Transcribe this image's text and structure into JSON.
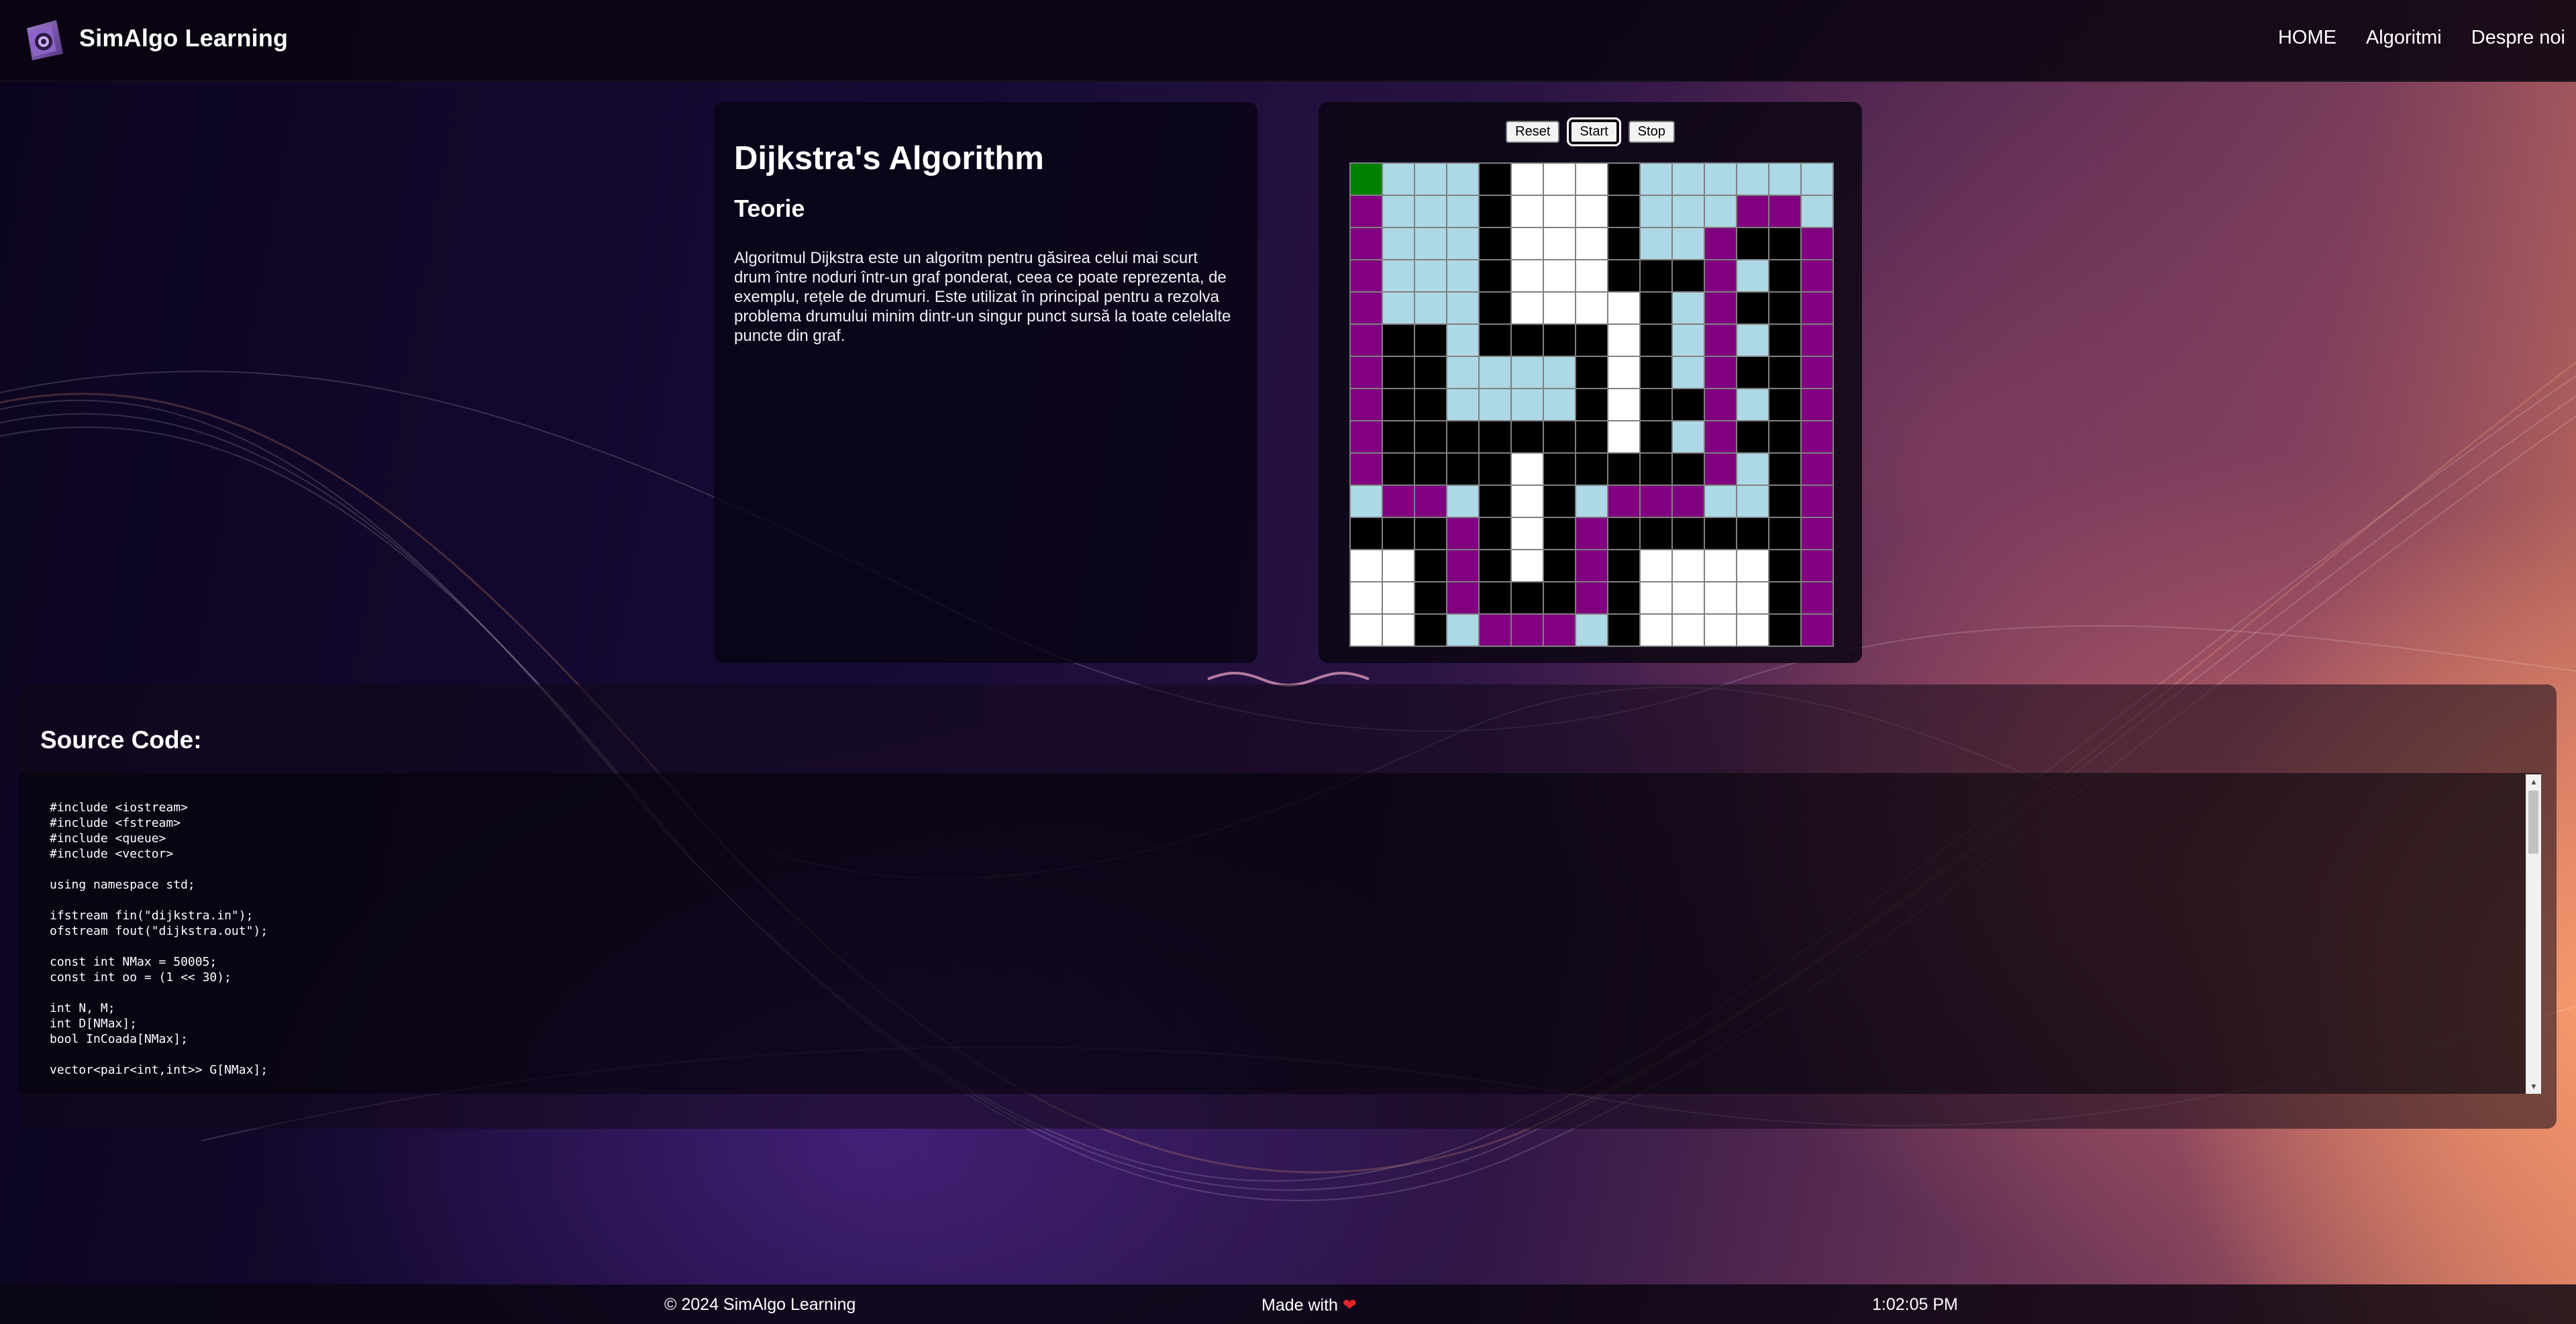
{
  "navbar": {
    "brand": "SimAlgo Learning",
    "links": [
      "HOME",
      "Algoritmi",
      "Despre noi"
    ]
  },
  "theory": {
    "title": "Dijkstra's Algorithm",
    "heading": "Teorie",
    "text": "Algoritmul Dijkstra este un algoritm pentru găsirea celui mai scurt drum între noduri într-un graf ponderat, ceea ce poate reprezenta, de exemplu, rețele de drumuri. Este utilizat în principal pentru a rezolva problema drumului minim dintr-un singur punct sursă la toate celelalte puncte din graf."
  },
  "controls": {
    "reset": "Reset",
    "start": "Start",
    "stop": "Stop",
    "active": "start"
  },
  "grid": {
    "legend": {
      "S": "start",
      "W": "wall",
      "V": "visited",
      "P": "path",
      "E": "empty"
    },
    "colors": {
      "S": "#008000",
      "W": "#000000",
      "V": "#add8e6",
      "P": "#800080",
      "E": "#ffffff",
      "line": "#808080"
    },
    "rows": [
      "SVVVWEEEWVVVVVV",
      "PVVVWEEEWVVVPPV",
      "PVVVWEEEWVVPWWP",
      "PVVVWEEEWWWPVWP",
      "PVVVWEEEEWVPWWP",
      "PWWVWWWWEWVPVWP",
      "PWWVVVVWEWVPWWP",
      "PWWVVVVWEWWPVWP",
      "PWWWWWWWEWVPWWP",
      "PWWWWEWWWWWPVWP",
      "VPPVWEWVPPPVVWP",
      "WWWPWEWPWWWWWWP",
      "EEWPWEWPWEEEEWP",
      "EEWPWWWPWEEEEWP",
      "EEWVPPPVWEEEEWP"
    ]
  },
  "source": {
    "title": "Source Code:",
    "code": "#include <iostream>\n#include <fstream>\n#include <queue>\n#include <vector>\n\nusing namespace std;\n\nifstream fin(\"dijkstra.in\");\nofstream fout(\"dijkstra.out\");\n\nconst int NMax = 50005;\nconst int oo = (1 << 30);\n\nint N, M;\nint D[NMax];\nbool InCoada[NMax];\n\nvector<pair<int,int>> G[NMax];"
  },
  "footer": {
    "copyright": "© 2024 SimAlgo Learning",
    "made_with": "Made with",
    "heart": "❤",
    "time": "1:02:05 PM"
  }
}
